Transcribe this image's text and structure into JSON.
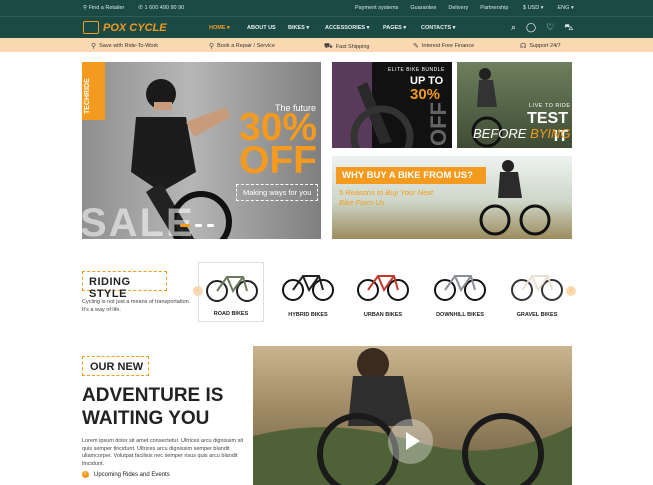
{
  "topbar": {
    "retailer": "Find a Retailer",
    "phone": "1 600 490 90 90",
    "links": [
      "Payment systems",
      "Guarantee",
      "Delivery",
      "Partnership"
    ],
    "currency": "$ USD",
    "language": "ENG"
  },
  "header": {
    "logo": "POX CYCLE",
    "menu": [
      "HOME",
      "ABOUT US",
      "BIKES",
      "ACCESSORIES",
      "PAGES",
      "CONTACTS"
    ],
    "active_color": "#f39a1f"
  },
  "promo": [
    "Save with Ride-To-Work",
    "Book a Repair / Service",
    "Fast Shipping",
    "Interest Free Finance",
    "Support 24/7"
  ],
  "hero": {
    "tag": "TECHRIDE",
    "future": "The future",
    "discount": "30%",
    "off": "OFF",
    "ways": "Making ways for you",
    "watermark": "SALE",
    "slide_count": 3,
    "active_slide": 1
  },
  "tile1": {
    "header": "ELITE BIKE BUNDLE",
    "up_to": "UP TO",
    "percent": "30%",
    "off": "OFF"
  },
  "tile2": {
    "live": "LIVE TO RIDE",
    "test": "TEST IT",
    "before": "BEFORE",
    "buying": "BYING"
  },
  "tile3": {
    "why": "WHY BUY A BIKE FROM US?",
    "sub": "5 Reasons to Buy Your Next Bike Form Us"
  },
  "riding_style": {
    "title": "RIDING STYLE",
    "text": "Cycling is not just a means of transportation. It's a way of life.",
    "bikes": [
      {
        "label": "ROAD BIKES",
        "selected": true
      },
      {
        "label": "HYBRID BIKES",
        "selected": false
      },
      {
        "label": "URBAN BIKES",
        "selected": false
      },
      {
        "label": "DOWNHILL BIKES",
        "selected": false
      },
      {
        "label": "GRAVEL BIKES",
        "selected": false
      }
    ]
  },
  "adventure": {
    "badge": "OUR NEW",
    "line1": "ADVENTURE IS",
    "line2": "WAITING YOU",
    "lorem": "Lorem ipsum dolor sit amet consectetur. Ultrices arcu dignissim sit quis semper tincidunt. Ultrices arcu dignissim semper blandit ullamcorper. Volutpat facilisis nec semper risus quis arcu blandit tincidunt.",
    "check1": "Upcoming Rides and Events"
  },
  "colors": {
    "brand": "#1b4a45",
    "accent": "#f39a1f",
    "promo_bg": "#fbd9b0"
  }
}
